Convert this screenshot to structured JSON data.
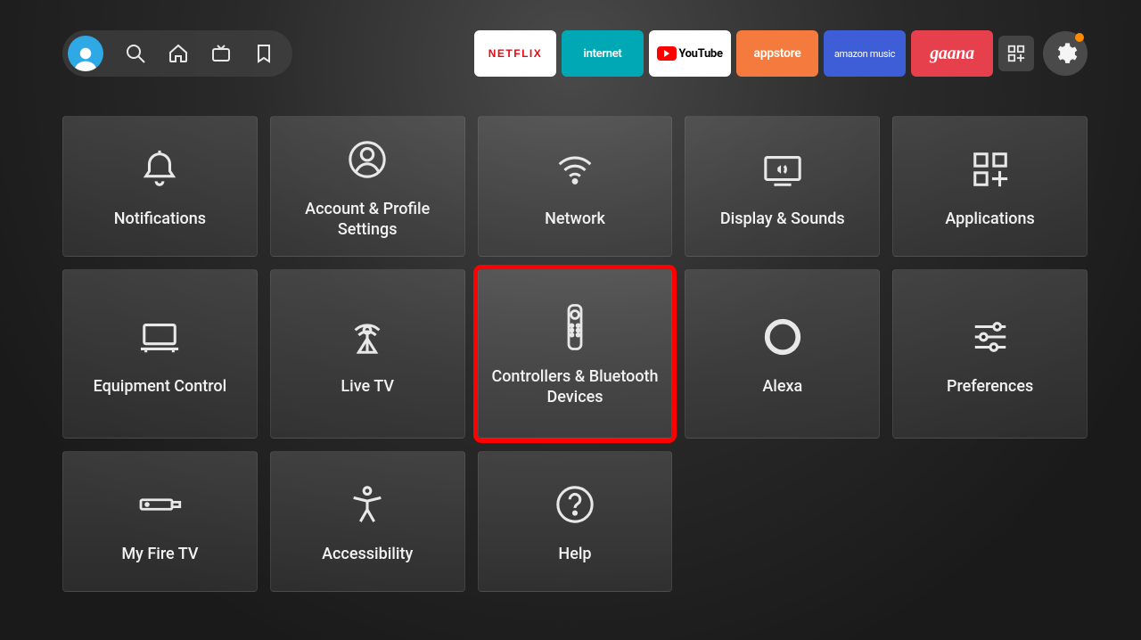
{
  "topApps": {
    "netflix": "NETFLIX",
    "internet": "internet",
    "youtube": "YouTube",
    "appstore": "appstore",
    "music": "amazon music",
    "gaana": "gaana"
  },
  "settings": [
    {
      "id": "notifications",
      "label": "Notifications"
    },
    {
      "id": "account",
      "label": "Account & Profile Settings"
    },
    {
      "id": "network",
      "label": "Network"
    },
    {
      "id": "display",
      "label": "Display & Sounds"
    },
    {
      "id": "applications",
      "label": "Applications"
    },
    {
      "id": "equipment",
      "label": "Equipment Control"
    },
    {
      "id": "livetv",
      "label": "Live TV"
    },
    {
      "id": "controllers",
      "label": "Controllers & Bluetooth Devices",
      "highlight": true
    },
    {
      "id": "alexa",
      "label": "Alexa"
    },
    {
      "id": "preferences",
      "label": "Preferences"
    },
    {
      "id": "myfiretv",
      "label": "My Fire TV"
    },
    {
      "id": "accessibility",
      "label": "Accessibility"
    },
    {
      "id": "help",
      "label": "Help"
    }
  ]
}
